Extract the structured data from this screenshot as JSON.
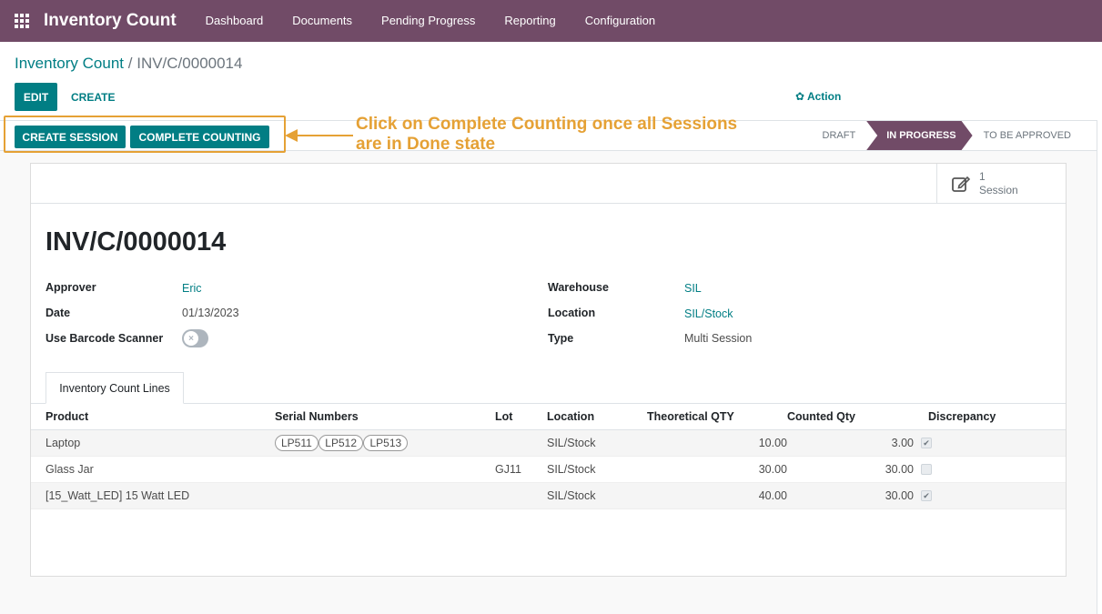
{
  "navbar": {
    "app_name": "Inventory Count",
    "menu": [
      "Dashboard",
      "Documents",
      "Pending Progress",
      "Reporting",
      "Configuration"
    ]
  },
  "breadcrumb": {
    "parent": "Inventory Count",
    "separator": "/",
    "current": "INV/C/0000014"
  },
  "toolbar": {
    "edit_label": "EDIT",
    "create_label": "CREATE",
    "action_label": "Action"
  },
  "statusbar": {
    "create_session_label": "CREATE SESSION",
    "complete_counting_label": "COMPLETE COUNTING",
    "stages": [
      "DRAFT",
      "IN PROGRESS",
      "TO BE APPROVED"
    ],
    "active_stage": "IN PROGRESS"
  },
  "annotation": {
    "line1": "Click on Complete Counting once all Sessions",
    "line2": "are in Done state",
    "color": "#e5a135"
  },
  "smart_button": {
    "count": "1",
    "label": "Session"
  },
  "record": {
    "name": "INV/C/0000014",
    "approver_label": "Approver",
    "approver": "Eric",
    "date_label": "Date",
    "date": "01/13/2023",
    "barcode_label": "Use Barcode Scanner",
    "warehouse_label": "Warehouse",
    "warehouse": "SIL",
    "location_label": "Location",
    "location": "SIL/Stock",
    "type_label": "Type",
    "type": "Multi Session"
  },
  "tab": {
    "label": "Inventory Count Lines"
  },
  "lines": {
    "headers": [
      "Product",
      "Serial Numbers",
      "Lot",
      "Location",
      "Theoretical QTY",
      "Counted Qty",
      "Discrepancy"
    ],
    "rows": [
      {
        "product": "Laptop",
        "serials": [
          "LP511",
          "LP512",
          "LP513"
        ],
        "lot": "",
        "location": "SIL/Stock",
        "theoretical": "10.00",
        "counted": "3.00",
        "discrepancy": true
      },
      {
        "product": "Glass Jar",
        "serials": [],
        "lot": "GJ11",
        "location": "SIL/Stock",
        "theoretical": "30.00",
        "counted": "30.00",
        "discrepancy": false
      },
      {
        "product": "[15_Watt_LED] 15 Watt LED",
        "serials": [],
        "lot": "",
        "location": "SIL/Stock",
        "theoretical": "40.00",
        "counted": "30.00",
        "discrepancy": true
      }
    ]
  },
  "colors": {
    "brand": "#714b67",
    "primary": "#017e84",
    "highlight": "#e5a135"
  }
}
